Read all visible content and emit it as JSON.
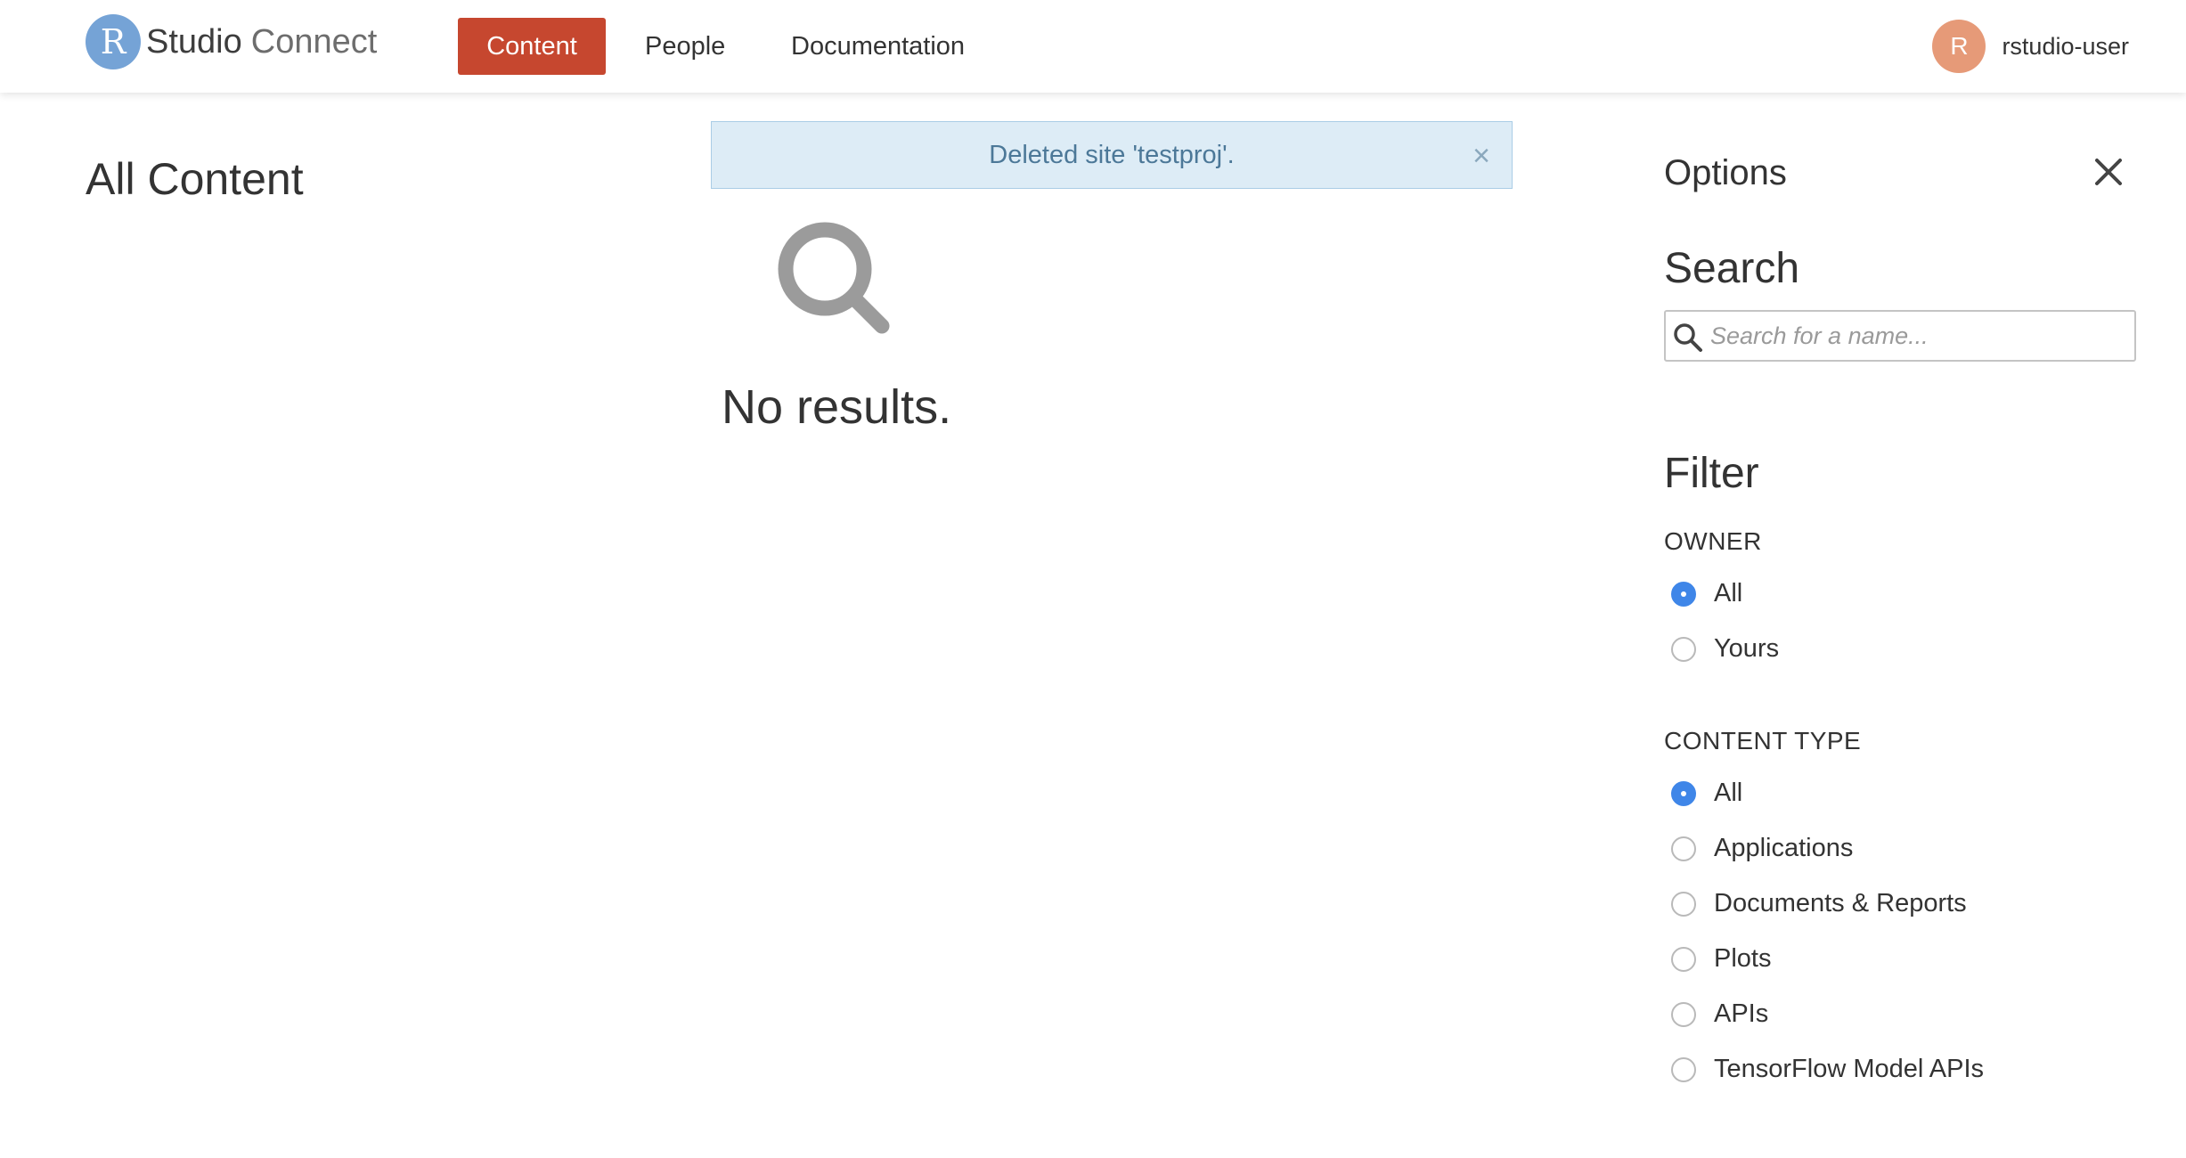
{
  "header": {
    "logo": {
      "badge": "R",
      "word1": "Studio",
      "word2": "Connect"
    },
    "nav": [
      {
        "label": "Content",
        "active": true
      },
      {
        "label": "People",
        "active": false
      },
      {
        "label": "Documentation",
        "active": false
      }
    ],
    "user": {
      "avatar_initial": "R",
      "name": "rstudio-user"
    }
  },
  "main": {
    "title": "All Content",
    "alert": {
      "message": "Deleted site 'testproj'.",
      "close_glyph": "×"
    },
    "empty_state": {
      "icon": "search-icon",
      "text": "No results."
    }
  },
  "options": {
    "title": "Options",
    "close_icon": "close-icon",
    "search": {
      "title": "Search",
      "placeholder": "Search for a name...",
      "value": ""
    },
    "filter": {
      "title": "Filter",
      "owner": {
        "label": "OWNER",
        "options": [
          {
            "label": "All",
            "checked": true
          },
          {
            "label": "Yours",
            "checked": false
          }
        ]
      },
      "content_type": {
        "label": "CONTENT TYPE",
        "options": [
          {
            "label": "All",
            "checked": true
          },
          {
            "label": "Applications",
            "checked": false
          },
          {
            "label": "Documents & Reports",
            "checked": false
          },
          {
            "label": "Plots",
            "checked": false
          },
          {
            "label": "APIs",
            "checked": false
          },
          {
            "label": "TensorFlow Model APIs",
            "checked": false
          }
        ]
      }
    }
  },
  "colors": {
    "accent": "#c6472f",
    "logo_badge": "#75a3d6",
    "avatar": "#e69a78",
    "alert_bg": "#ddecf6",
    "alert_text": "#4c7898",
    "radio_checked": "#3f86e8"
  }
}
